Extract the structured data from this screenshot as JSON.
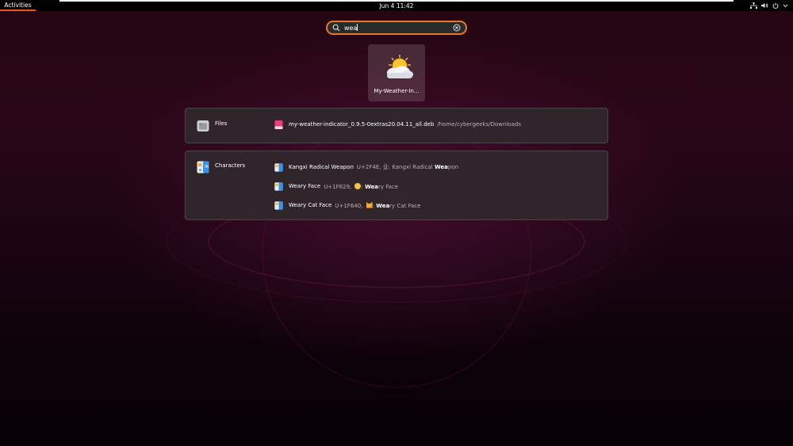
{
  "topbar": {
    "activities_label": "Activities",
    "clock": "Jun 4  11:42"
  },
  "search": {
    "value": "wea"
  },
  "app_result": {
    "label": "My-Weather-In..."
  },
  "files": {
    "provider_label": "Files",
    "results": [
      {
        "title": "my-weather-indicator_0.9.5-0extras20.04.11_all.deb",
        "description": "/home/cybergeeks/Downloads"
      }
    ]
  },
  "characters": {
    "provider_label": "Characters",
    "results": [
      {
        "title": "Kangxi Radical Weapon",
        "description_prefix": "U+2F4E, ⽎: Kangxi Radical ",
        "description_bold": "Wea",
        "description_suffix": "pon"
      },
      {
        "title": "Weary Face",
        "description_prefix": "U+1F629, ",
        "description_bold": "Wea",
        "description_suffix": "ry Face"
      },
      {
        "title": "Weary Cat Face",
        "description_prefix": "U+1F640, ",
        "description_bold": "Wea",
        "description_suffix": "ry Cat Face"
      }
    ]
  },
  "colors": {
    "accent": "#e95420",
    "search_border": "#e9772e"
  }
}
